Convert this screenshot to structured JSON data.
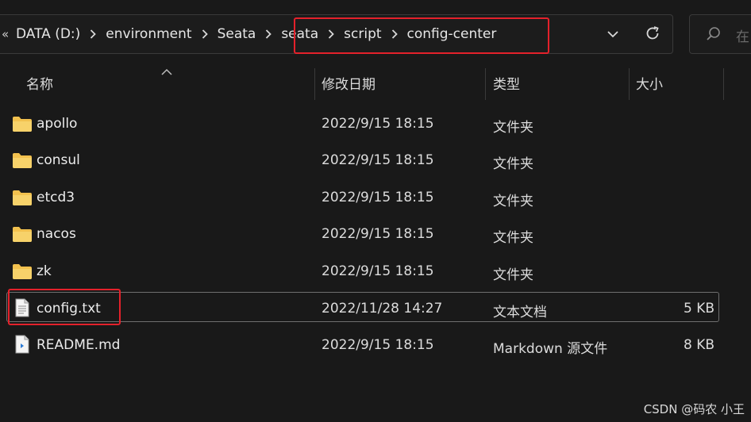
{
  "address_bar": {
    "overflow_glyph": "«",
    "crumbs_before": [
      "DATA (D:)",
      "environment",
      "Seata"
    ],
    "crumbs_highlighted": [
      "seata",
      "script",
      "config-center"
    ]
  },
  "search": {
    "placeholder": "在"
  },
  "columns": {
    "name": "名称",
    "modified": "修改日期",
    "type": "类型",
    "size": "大小"
  },
  "rows": [
    {
      "name": "apollo",
      "date": "2022/9/15 18:15",
      "type": "文件夹",
      "size": "",
      "icon": "folder-icon"
    },
    {
      "name": "consul",
      "date": "2022/9/15 18:15",
      "type": "文件夹",
      "size": "",
      "icon": "folder-icon"
    },
    {
      "name": "etcd3",
      "date": "2022/9/15 18:15",
      "type": "文件夹",
      "size": "",
      "icon": "folder-icon"
    },
    {
      "name": "nacos",
      "date": "2022/9/15 18:15",
      "type": "文件夹",
      "size": "",
      "icon": "folder-icon"
    },
    {
      "name": "zk",
      "date": "2022/9/15 18:15",
      "type": "文件夹",
      "size": "",
      "icon": "folder-icon"
    },
    {
      "name": "config.txt",
      "date": "2022/11/28 14:27",
      "type": "文本文档",
      "size": "5 KB",
      "icon": "text-file-icon",
      "selected": true
    },
    {
      "name": "README.md",
      "date": "2022/9/15 18:15",
      "type": "Markdown 源文件",
      "size": "8 KB",
      "icon": "markdown-file-icon"
    }
  ],
  "watermark": "CSDN @码农 小王",
  "colors": {
    "background": "#191919",
    "highlight": "#e4212b",
    "folder": "#f2c14e"
  }
}
